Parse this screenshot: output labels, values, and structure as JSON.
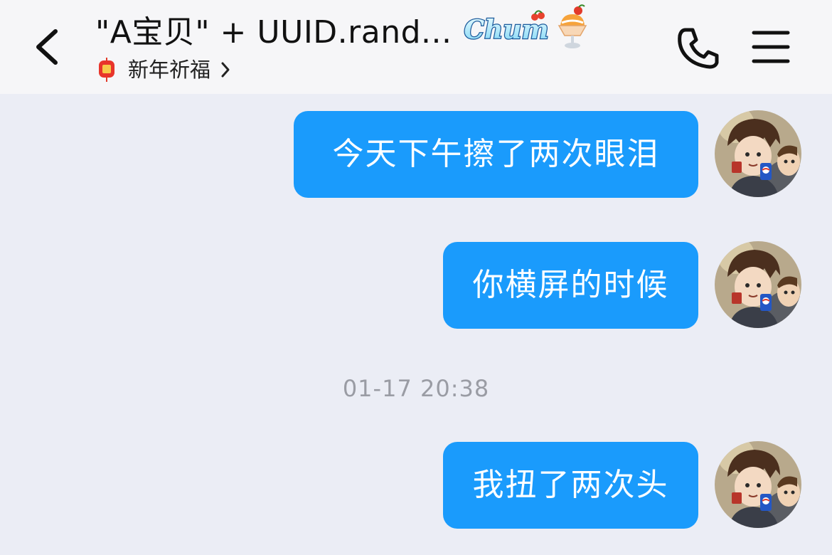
{
  "header": {
    "title": "\"A宝贝\" + UUID.rand...",
    "badge_text": "Chum",
    "subtitle": "新年祈福",
    "back_icon": "chevron-left-icon",
    "phone_icon": "phone-icon",
    "menu_icon": "hamburger-menu-icon",
    "subtitle_icon": "fu-lantern-icon",
    "badge_icon": "sundae-icon"
  },
  "messages": [
    {
      "text": "今天下午擦了两次眼泪",
      "sender": "self"
    },
    {
      "text": "你横屏的时候",
      "sender": "self"
    },
    {
      "timestamp": "01-17 20:38"
    },
    {
      "text": "我扭了两次头",
      "sender": "self"
    }
  ],
  "colors": {
    "bubble_bg": "#1a9bfc",
    "bubble_text": "#ffffff",
    "chat_bg": "#ebedf5",
    "header_bg": "#f6f6f8",
    "timestamp_text": "#9a9ca4"
  }
}
